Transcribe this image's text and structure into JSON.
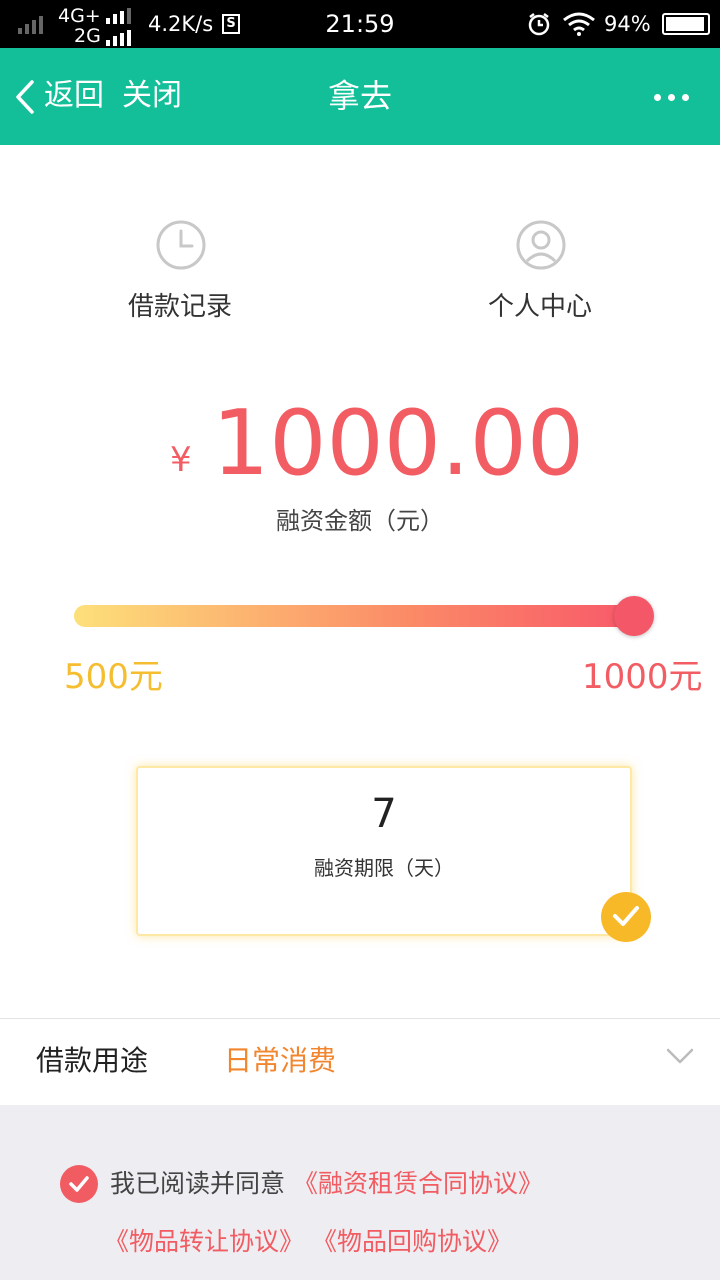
{
  "status_bar": {
    "network_top": "4G+",
    "network_bottom": "2G",
    "speed": "4.2K/s",
    "s_badge": "S",
    "time": "21:59",
    "battery_percent": "94%",
    "battery_level": 0.94,
    "icons": [
      "signal-icon",
      "alarm-icon",
      "wifi-icon",
      "battery-icon"
    ]
  },
  "nav": {
    "back_label": "返回",
    "close_label": "关闭",
    "title": "拿去",
    "more_icon": "more-dots-icon",
    "background": "#12bf99"
  },
  "quick_actions": [
    {
      "label": "借款记录",
      "icon": "clock-icon"
    },
    {
      "label": "个人中心",
      "icon": "user-icon"
    }
  ],
  "loan": {
    "currency": "¥",
    "amount": "1000.00",
    "amount_label": "融资金额（元）",
    "accent_color": "#f25c63"
  },
  "slider": {
    "min_label": "500元",
    "max_label": "1000元",
    "min": 500,
    "max": 1000,
    "value": 1000
  },
  "term": {
    "value": "7",
    "label": "融资期限（天）",
    "selected": true
  },
  "purpose": {
    "label": "借款用途",
    "value": "日常消费"
  },
  "agreement": {
    "checked": true,
    "text": "我已阅读并同意",
    "links": [
      "《融资租赁合同协议》",
      "《物品转让协议》",
      "《物品回购协议》"
    ]
  }
}
